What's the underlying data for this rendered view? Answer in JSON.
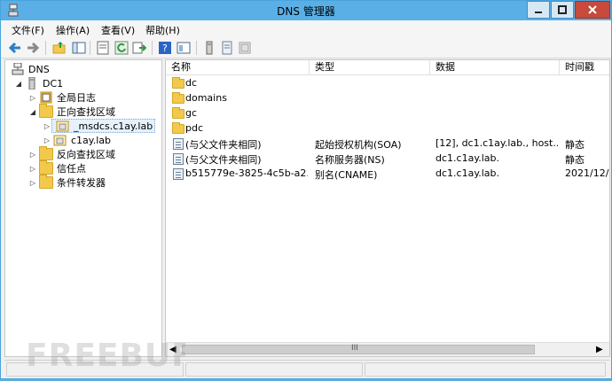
{
  "window": {
    "title": "DNS 管理器"
  },
  "menubar": {
    "items": [
      {
        "label": "文件(F)"
      },
      {
        "label": "操作(A)"
      },
      {
        "label": "查看(V)"
      },
      {
        "label": "帮助(H)"
      }
    ]
  },
  "tree": {
    "root": "DNS",
    "server": "DC1",
    "global_logs": "全局日志",
    "forward_zones": "正向查找区域",
    "zone_msdcs": "_msdcs.c1ay.lab",
    "zone_c1ay": "c1ay.lab",
    "reverse_zones": "反向查找区域",
    "trust_points": "信任点",
    "conditional_forwarders": "条件转发器"
  },
  "list": {
    "columns": [
      {
        "label": "名称"
      },
      {
        "label": "类型"
      },
      {
        "label": "数据"
      },
      {
        "label": "时间戳"
      }
    ],
    "folders": [
      {
        "name": "dc"
      },
      {
        "name": "domains"
      },
      {
        "name": "gc"
      },
      {
        "name": "pdc"
      }
    ],
    "records": [
      {
        "name": "(与父文件夹相同)",
        "type": "起始授权机构(SOA)",
        "data": "[12], dc1.c1ay.lab., host...",
        "timestamp": "静态"
      },
      {
        "name": "(与父文件夹相同)",
        "type": "名称服务器(NS)",
        "data": "dc1.c1ay.lab.",
        "timestamp": "静态"
      },
      {
        "name": "b515779e-3825-4c5b-a2...",
        "type": "别名(CNAME)",
        "data": "dc1.c1ay.lab.",
        "timestamp": "2021/12/"
      }
    ]
  },
  "scrollbar": {
    "thumb_grip": "III"
  },
  "colors": {
    "titlebar": "#5ab0e6",
    "folder": "#f2c94c",
    "close_button": "#c74a3b"
  }
}
